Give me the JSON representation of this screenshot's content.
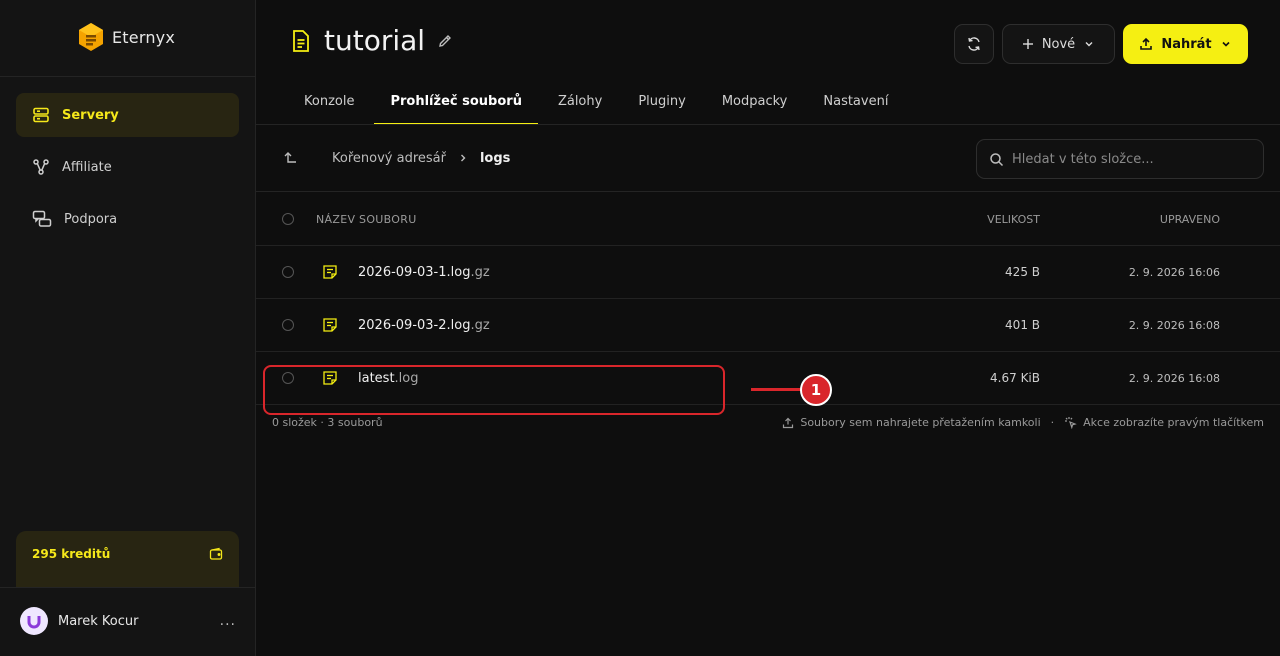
{
  "app": {
    "brand": "Eternyx"
  },
  "sidebar": {
    "items": [
      {
        "label": "Servery",
        "icon": "server-icon",
        "active": true
      },
      {
        "label": "Affiliate",
        "icon": "share-nodes-icon",
        "active": false
      },
      {
        "label": "Podpora",
        "icon": "chat-bubbles-icon",
        "active": false
      }
    ],
    "credits_label": "295 kreditů",
    "user_name": "Marek Kocur",
    "more": "..."
  },
  "header": {
    "title": "tutorial",
    "new_label": "Nové",
    "upload_label": "Nahrát"
  },
  "tabs": [
    {
      "label": "Konzole",
      "active": false
    },
    {
      "label": "Prohlížeč souborů",
      "active": true
    },
    {
      "label": "Zálohy",
      "active": false
    },
    {
      "label": "Pluginy",
      "active": false
    },
    {
      "label": "Modpacky",
      "active": false
    },
    {
      "label": "Nastavení",
      "active": false
    }
  ],
  "breadcrumb": {
    "root": "Kořenový adresář",
    "current": "logs"
  },
  "search": {
    "placeholder": "Hledat v této složce..."
  },
  "table": {
    "headers": {
      "name": "NÁZEV SOUBORU",
      "size": "VELIKOST",
      "modified": "UPRAVENO"
    },
    "rows": [
      {
        "base": "2026-09-03-1.log",
        "ext": ".gz",
        "size": "425 B",
        "modified": "2. 9. 2026 16:06"
      },
      {
        "base": "2026-09-03-2.log",
        "ext": ".gz",
        "size": "401 B",
        "modified": "2. 9. 2026 16:08"
      },
      {
        "base": "latest",
        "ext": ".log",
        "size": "4.67 KiB",
        "modified": "2. 9. 2026 16:08"
      }
    ]
  },
  "footer": {
    "count": "0 složek · 3 souborů",
    "hint_upload": "Soubory sem nahrajete přetažením kamkoli",
    "separator": "·",
    "hint_actions": "Akce zobrazíte pravým tlačítkem"
  },
  "annotation": {
    "badge": "1"
  },
  "colors": {
    "accent": "#f5ef12",
    "annotation": "#d9262b",
    "background": "#0e0e0e"
  }
}
